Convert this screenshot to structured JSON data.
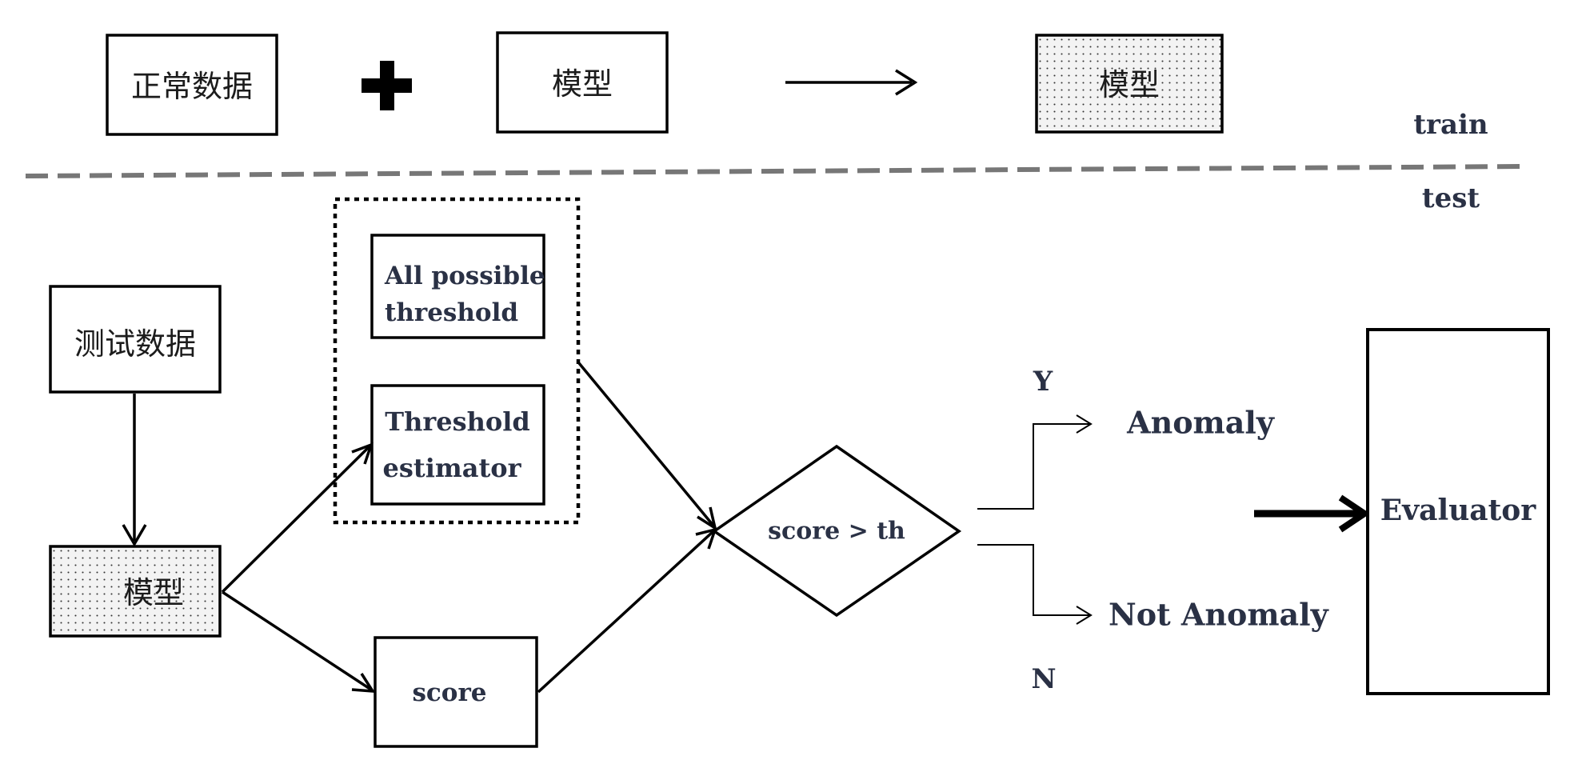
{
  "train": {
    "label": "train",
    "normal_data": "正常数据",
    "model": "模型",
    "trained_model": "模型"
  },
  "test": {
    "label": "test",
    "test_data": "测试数据",
    "trained_model": "模型",
    "thresholds": {
      "all_possible": [
        "All possible",
        "threshold"
      ],
      "estimator": [
        "Threshold",
        "estimator"
      ]
    },
    "score": "score",
    "decision": "score > th",
    "yes_label": "Y",
    "no_label": "N",
    "anomaly": "Anomaly",
    "not_anomaly": "Not Anomaly",
    "evaluator": "Evaluator"
  },
  "colors": {
    "stroke": "#000000",
    "text_dark": "#2a3145",
    "divider": "#777777",
    "dot": "#333333"
  }
}
